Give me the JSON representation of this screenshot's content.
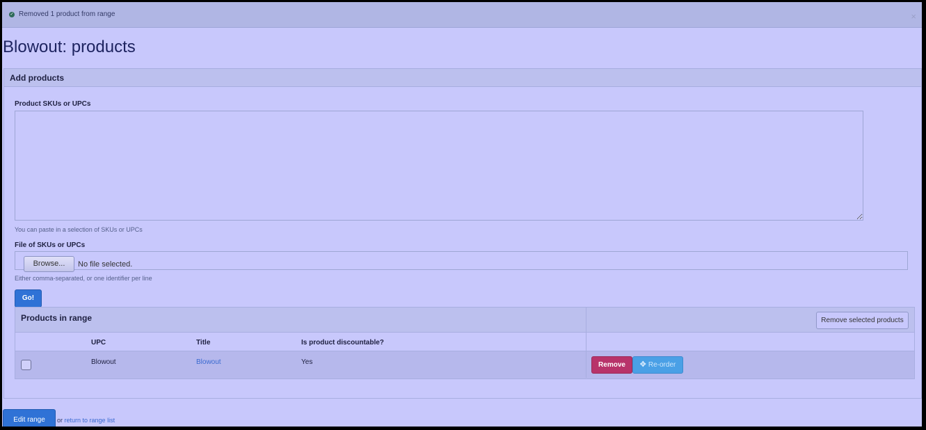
{
  "alert": {
    "message": "Removed 1 product from range",
    "close": "×"
  },
  "page": {
    "title": "Blowout: products"
  },
  "add_products": {
    "heading": "Add products",
    "skus_label": "Product SKUs or UPCs",
    "skus_value": "",
    "skus_help": "You can paste in a selection of SKUs or UPCs",
    "file_label": "File of SKUs or UPCs",
    "browse_label": "Browse...",
    "file_status": "No file selected.",
    "file_help": "Either comma-separated, or one identifier per line",
    "go_label": "Go!"
  },
  "range": {
    "heading": "Products in range",
    "remove_selected_label": "Remove selected products",
    "columns": [
      "UPC",
      "Title",
      "Is product discountable?"
    ],
    "rows": [
      {
        "upc": "Blowout",
        "title": "Blowout",
        "discountable": "Yes",
        "checked": false
      }
    ],
    "remove_label": "Remove",
    "reorder_label": "Re-order"
  },
  "footer": {
    "edit_range_label": "Edit range",
    "or_text": "or",
    "return_link": "return to range list"
  },
  "icons": {
    "alert": "check-circle-icon",
    "reorder": "move-icon"
  }
}
